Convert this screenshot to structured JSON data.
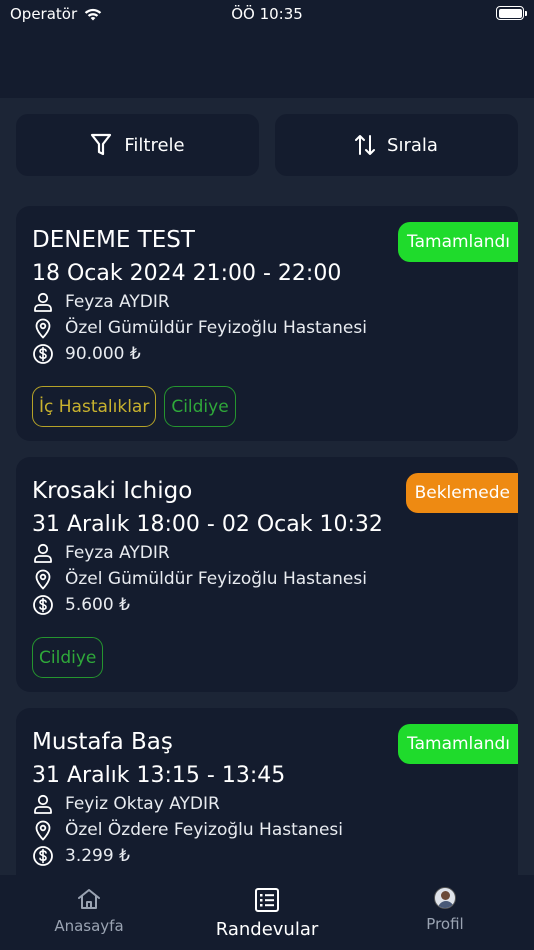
{
  "status_bar": {
    "carrier": "Operatör",
    "time": "ÖÖ 10:35"
  },
  "toolbar": {
    "filter_label": "Filtrele",
    "sort_label": "Sırala"
  },
  "appointments": [
    {
      "title": "DENEME TEST",
      "date": "18 Ocak 2024 21:00 - 22:00",
      "doctor": "Feyza AYDIR",
      "hospital": "Özel Gümüldür Feyizoğlu Hastanesi",
      "price": "90.000 ₺",
      "status": "Tamamlandı",
      "tags": [
        "İç Hastalıklar",
        "Cildiye"
      ]
    },
    {
      "title": "Krosaki Ichigo",
      "date": "31 Aralık 18:00 - 02 Ocak 10:32",
      "doctor": "Feyza AYDIR",
      "hospital": "Özel Gümüldür Feyizoğlu Hastanesi",
      "price": "5.600 ₺",
      "status": "Beklemede",
      "tags": [
        "Cildiye"
      ]
    },
    {
      "title": "Mustafa Baş",
      "date": "31 Aralık 13:15 - 13:45",
      "doctor": "Feyiz Oktay AYDIR",
      "hospital": "Özel Özdere Feyizoğlu Hastanesi",
      "price": "3.299 ₺",
      "status": "Tamamlandı",
      "tags": []
    }
  ],
  "tabs": {
    "home": "Anasayfa",
    "appointments": "Randevular",
    "profile": "Profil"
  },
  "colors": {
    "background": "#1c2536",
    "card": "#141c2e",
    "completed": "#1fdb2c",
    "pending": "#ee8a12",
    "tag_yellow": "#c8b22e",
    "tag_green": "#2fa83a"
  },
  "icons": {
    "filter": "filter-icon",
    "sort": "sort-icon",
    "person": "person-icon",
    "location": "location-pin-icon",
    "price": "dollar-circle-icon",
    "home": "home-icon",
    "list": "list-icon"
  }
}
